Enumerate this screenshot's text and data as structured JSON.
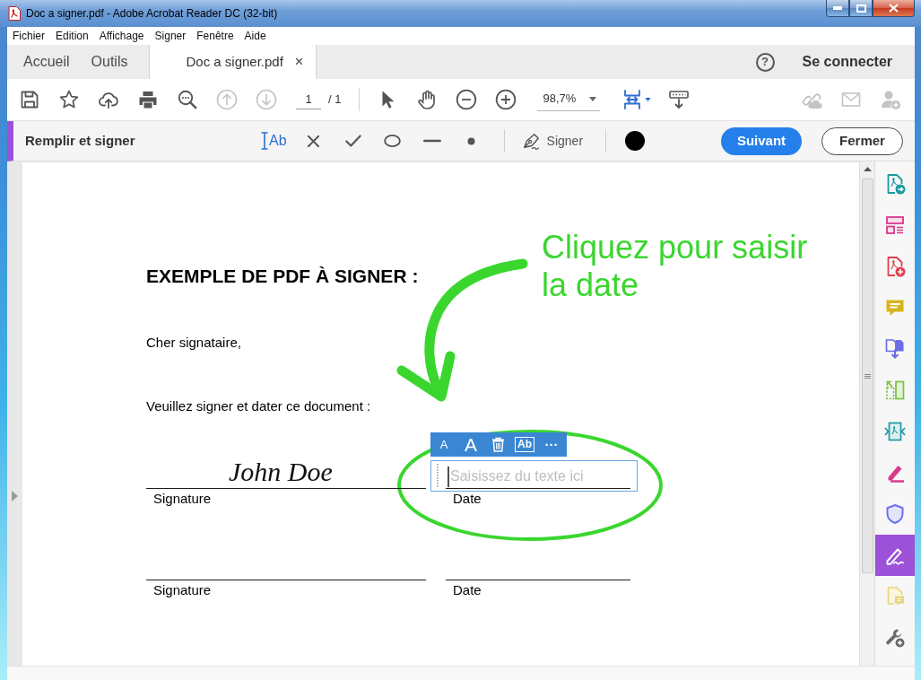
{
  "window": {
    "title": "Doc a signer.pdf - Adobe Acrobat Reader DC (32-bit)"
  },
  "menu": [
    "Fichier",
    "Edition",
    "Affichage",
    "Signer",
    "Fenêtre",
    "Aide"
  ],
  "tabs": [
    {
      "kind": "nav",
      "label": "Accueil",
      "selected": false
    },
    {
      "kind": "nav",
      "label": "Outils",
      "selected": false
    },
    {
      "kind": "document",
      "label": "Doc a signer.pdf",
      "selected": true,
      "close": "×"
    }
  ],
  "header_right": {
    "help": "?",
    "sign_in": "Se connecter"
  },
  "toolbar": {
    "groups": [
      {
        "items": [
          {
            "kind": "save",
            "disabled": false
          },
          {
            "kind": "bookmark",
            "disabled": false
          },
          {
            "kind": "upload",
            "disabled": false
          },
          {
            "kind": "print",
            "disabled": false
          },
          {
            "kind": "find",
            "disabled": false
          },
          {
            "kind": "previous-page",
            "disabled": true
          },
          {
            "kind": "next-page",
            "disabled": true
          },
          {
            "kind": "page",
            "value": "1",
            "total": "/ 1"
          }
        ]
      },
      {
        "items": [
          {
            "kind": "select",
            "disabled": false
          },
          {
            "kind": "hand",
            "disabled": false
          },
          {
            "kind": "zoom-out",
            "disabled": false
          },
          {
            "kind": "zoom-in",
            "disabled": false
          },
          {
            "kind": "zoom",
            "value": "98,7%"
          },
          {
            "kind": "fit-page",
            "disabled": false
          },
          {
            "kind": "read-mode",
            "disabled": false
          }
        ]
      },
      {
        "items": [
          {
            "kind": "share-link",
            "disabled": true
          },
          {
            "kind": "email",
            "disabled": true
          },
          {
            "kind": "add-user",
            "disabled": true
          }
        ]
      }
    ]
  },
  "fill_sign": {
    "title": "Remplir et signer",
    "tools": [
      {
        "kind": "text",
        "label": "Ab",
        "selected": true
      },
      {
        "kind": "cross",
        "selected": false
      },
      {
        "kind": "check",
        "selected": false
      },
      {
        "kind": "ellipse",
        "selected": false
      },
      {
        "kind": "line",
        "selected": false
      },
      {
        "kind": "dot",
        "selected": false
      }
    ],
    "sign": "Signer",
    "color": "#000000",
    "buttons": [
      {
        "kind": "primary",
        "label": "Suivant"
      },
      {
        "kind": "secondary",
        "label": "Fermer"
      }
    ]
  },
  "document": {
    "heading": "EXEMPLE DE PDF À SIGNER :",
    "paragraphs": [
      "Cher signataire,",
      "Veuillez signer et dater ce document :"
    ],
    "signature_rows": [
      {
        "signature": {
          "label": "Signature",
          "signed": "John Doe"
        },
        "date": {
          "label": "Date",
          "editing": true,
          "editor": {
            "placeholder": "Saisissez du texte ici",
            "toolbar": [
              {
                "kind": "smaller",
                "label": "A"
              },
              {
                "kind": "larger",
                "label": "A"
              },
              {
                "kind": "delete"
              },
              {
                "kind": "field-type",
                "label": "Ab"
              },
              {
                "kind": "more",
                "label": "···"
              }
            ]
          }
        }
      },
      {
        "signature": {
          "label": "Signature"
        },
        "date": {
          "label": "Date",
          "editing": false
        }
      }
    ]
  },
  "annotation": {
    "text": "Cliquez pour saisir la date"
  },
  "right_panel": {
    "tools": [
      {
        "kind": "export",
        "selected": false
      },
      {
        "kind": "layout",
        "selected": false
      },
      {
        "kind": "create",
        "selected": false
      },
      {
        "kind": "comment",
        "selected": false
      },
      {
        "kind": "combine",
        "selected": false
      },
      {
        "kind": "organize",
        "selected": false
      },
      {
        "kind": "optimize",
        "selected": false
      },
      {
        "kind": "highlight",
        "selected": false
      },
      {
        "kind": "protect",
        "selected": false
      },
      {
        "kind": "fill-sign",
        "selected": true
      },
      {
        "kind": "send-comments",
        "selected": false
      },
      {
        "kind": "more-tools",
        "selected": false
      }
    ]
  }
}
